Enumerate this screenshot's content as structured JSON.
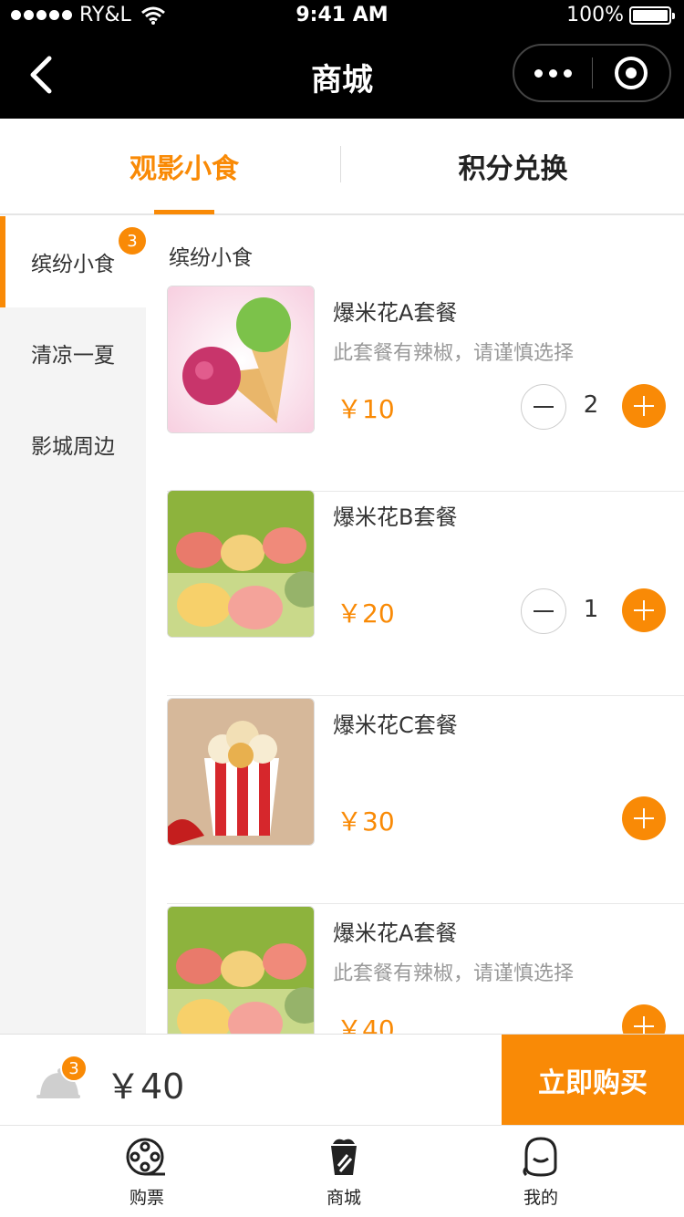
{
  "status_bar": {
    "carrier": "RY&L",
    "time": "9:41 AM",
    "battery": "100%"
  },
  "nav": {
    "title": "商城"
  },
  "tabs": [
    {
      "label": "观影小食",
      "active": true
    },
    {
      "label": "积分兑换",
      "active": false
    }
  ],
  "sidebar": {
    "items": [
      {
        "label": "缤纷小食",
        "badge": "3",
        "active": true
      },
      {
        "label": "清凉一夏"
      },
      {
        "label": "影城周边"
      }
    ]
  },
  "section_title": "缤纷小食",
  "products": [
    {
      "name": "爆米花A套餐",
      "desc": "此套餐有辣椒，请谨慎选择",
      "price": "￥10",
      "qty": "2"
    },
    {
      "name": "爆米花B套餐",
      "desc": "",
      "price": "￥20",
      "qty": "1"
    },
    {
      "name": "爆米花C套餐",
      "desc": "",
      "price": "￥30",
      "qty": ""
    },
    {
      "name": "爆米花A套餐",
      "desc": "此套餐有辣椒，请谨慎选择",
      "price": "￥40",
      "qty": ""
    }
  ],
  "cart": {
    "count": "3",
    "total": "￥40",
    "buy_label": "立即购买"
  },
  "tabbar": [
    {
      "label": "购票",
      "icon": "film-reel-icon"
    },
    {
      "label": "商城",
      "icon": "popcorn-icon"
    },
    {
      "label": "我的",
      "icon": "profile-icon"
    }
  ],
  "colors": {
    "accent": "#f98a06",
    "nav_bg": "#000000"
  }
}
